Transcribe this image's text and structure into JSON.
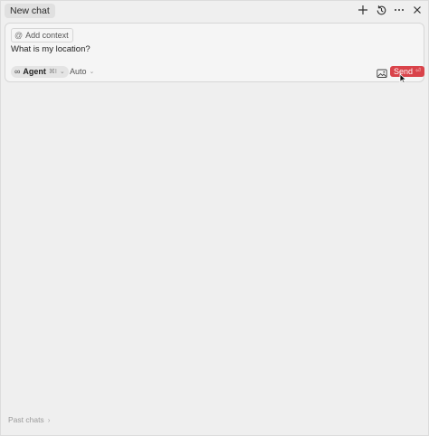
{
  "header": {
    "tab_label": "New chat",
    "actions": [
      {
        "name": "new-chat-icon"
      },
      {
        "name": "history-icon"
      },
      {
        "name": "more-icon"
      },
      {
        "name": "close-icon"
      }
    ]
  },
  "composer": {
    "add_context_symbol": "@",
    "add_context_label": "Add context",
    "prompt_text": "What is my location?",
    "agent": {
      "icon": "∞",
      "label": "Agent",
      "shortcut": "⌘I",
      "chevron": "⌄"
    },
    "model": {
      "label": "Auto",
      "chevron": "⌄"
    },
    "image_icon": "image-icon",
    "send": {
      "label": "Send",
      "return_symbol": "⏎"
    }
  },
  "footer": {
    "past_chats_label": "Past chats",
    "chevron": "›"
  },
  "colors": {
    "background": "#efefef",
    "send_button": "#d9434a",
    "tab_background": "#e0e0e0"
  }
}
